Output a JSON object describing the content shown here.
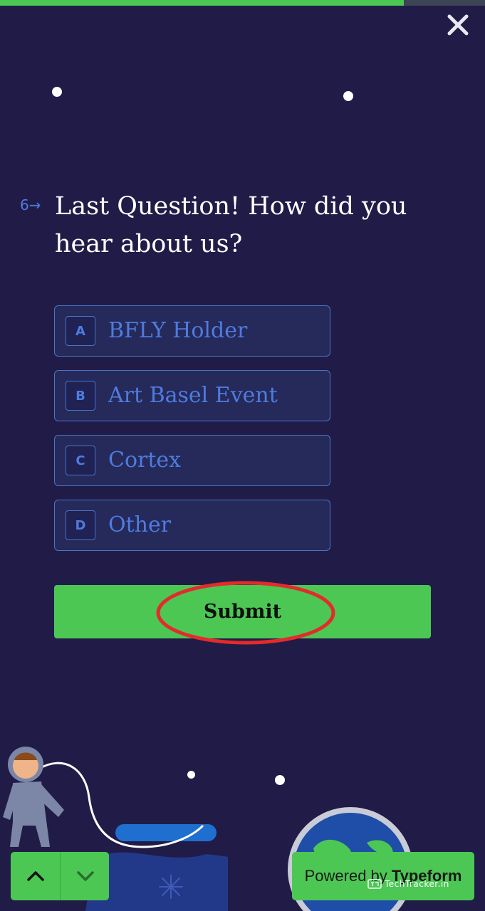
{
  "progress": {
    "fraction": 0.833
  },
  "question": {
    "number": "6→",
    "title": "Last Question! How did you hear about us?"
  },
  "choices": [
    {
      "key": "A",
      "label": "BFLY Holder"
    },
    {
      "key": "B",
      "label": "Art Basel Event"
    },
    {
      "key": "C",
      "label": "Cortex"
    },
    {
      "key": "D",
      "label": "Other"
    }
  ],
  "submit": {
    "label": "Submit"
  },
  "footer": {
    "powered_prefix": "Powered by",
    "powered_brand": "Typeform",
    "watermark": "TechTracker.in"
  },
  "icons": {
    "close": "close-icon",
    "up": "chevron-up-icon",
    "down": "chevron-down-icon"
  },
  "colors": {
    "background": "#201c47",
    "accent_green": "#4cc754",
    "choice_blue": "#4f7be0",
    "annotation_red": "#e32b2b"
  }
}
